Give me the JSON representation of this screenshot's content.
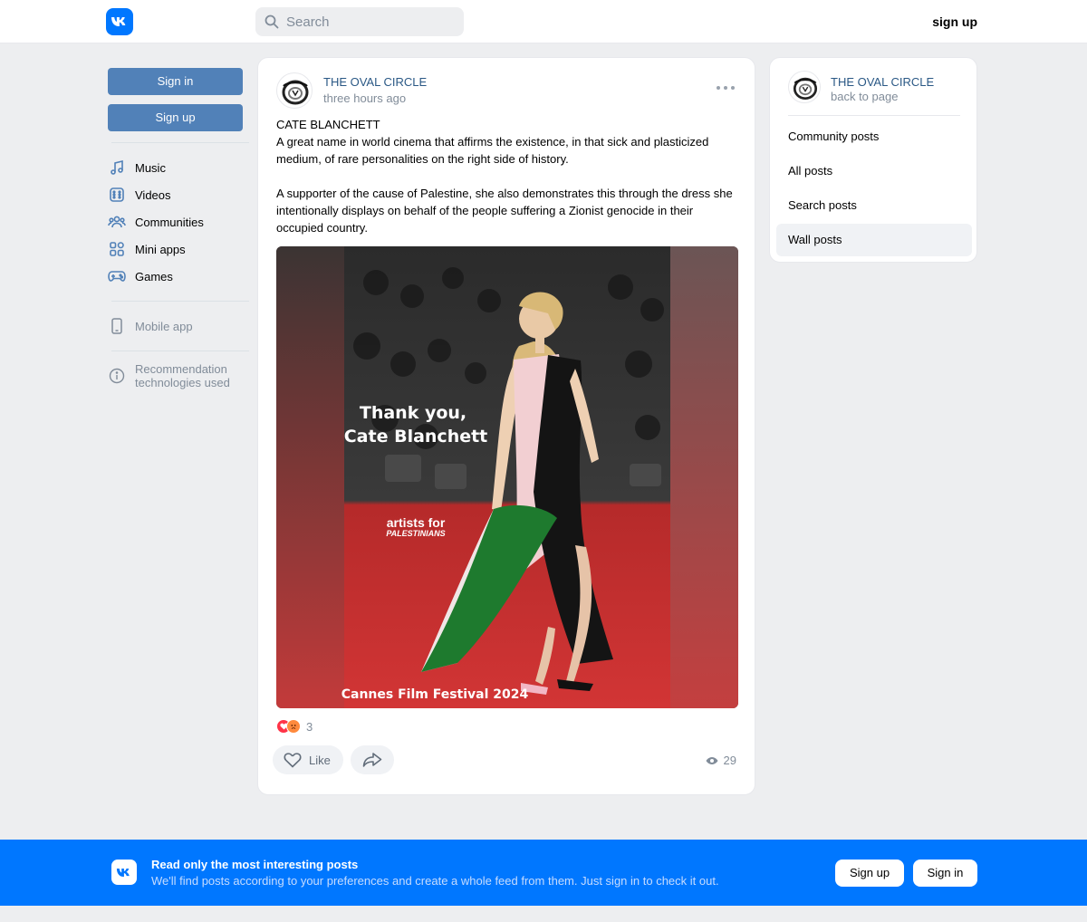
{
  "header": {
    "search_placeholder": "Search",
    "signup_label": "sign up"
  },
  "sidebar": {
    "signin_label": "Sign in",
    "signup_label": "Sign up",
    "nav": [
      {
        "label": "Music",
        "icon": "music-icon"
      },
      {
        "label": "Videos",
        "icon": "video-icon"
      },
      {
        "label": "Communities",
        "icon": "communities-icon"
      },
      {
        "label": "Mini apps",
        "icon": "mini-apps-icon"
      },
      {
        "label": "Games",
        "icon": "gamepad-icon"
      }
    ],
    "mobile_app": "Mobile app",
    "recommendation_line1": "Recommendation",
    "recommendation_line2": "technologies used"
  },
  "post": {
    "author": "THE OVAL CIRCLE",
    "time": "three hours ago",
    "text": "CATE BLANCHETT\nA great name in world cinema that affirms the existence, in that sick and plasticized medium, of rare personalities on the right side of history.\n\nA supporter of the cause of Palestine, she also demonstrates this through the dress she intentionally displays on behalf of the people suffering a Zionist genocide in their occupied country.",
    "image": {
      "caption_line1": "Thank you,",
      "caption_line2": "Cate Blanchett",
      "brand_line1": "artists for",
      "brand_line2": "PALESTINIANS",
      "footer": "Cannes Film Festival 2024"
    },
    "reactions_count": "3",
    "like_label": "Like",
    "views": "29"
  },
  "right_panel": {
    "name": "THE OVAL CIRCLE",
    "back": "back to page",
    "menu": [
      {
        "label": "Community posts"
      },
      {
        "label": "All posts"
      },
      {
        "label": "Search posts"
      },
      {
        "label": "Wall posts"
      }
    ]
  },
  "banner": {
    "title": "Read only the most interesting posts",
    "subtitle": "We'll find posts according to your preferences and create a whole feed from them. Just sign in to check it out.",
    "signup_label": "Sign up",
    "signin_label": "Sign in"
  },
  "colors": {
    "brand": "#0077ff",
    "button_blue": "#5181b8",
    "link": "#2a5885",
    "muted": "#818c99"
  }
}
